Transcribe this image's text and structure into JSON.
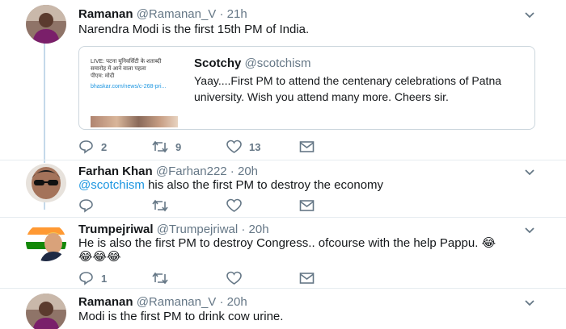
{
  "tweets": [
    {
      "name": "Ramanan",
      "meta": "@Ramanan_V · 21h",
      "text": "Narendra Modi is the first 15th PM of India.",
      "quoted": {
        "name": "Scotchy",
        "handle": "@scotchism",
        "text": "Yaay....First PM to attend the centenary celebrations of Patna university. Wish you attend many more. Cheers sir.",
        "thumb_lines": [
          "LIVE: पटना यूनिवर्सिटी के शताब्दी",
          "समारोह में आने वाला पहला",
          "पीएम: मोदी"
        ],
        "thumb_url": "bhaskar.com/news/c-268-pri..."
      },
      "replies": "2",
      "retweets": "9",
      "likes": "13"
    },
    {
      "name": "Farhan Khan",
      "meta": "@Farhan222 · 20h",
      "mention": "@scotchism",
      "text": " his also the first PM to destroy the economy",
      "replies": "",
      "retweets": "",
      "likes": ""
    },
    {
      "name": "Trumpejriwal",
      "meta": "@Trumpejriwal · 20h",
      "text": "He is also the first PM to destroy Congress..  ofcourse with the help Pappu. 😂",
      "text2": "😂😂😂",
      "replies": "1",
      "retweets": "",
      "likes": ""
    },
    {
      "name": "Ramanan",
      "meta": "@Ramanan_V · 20h",
      "text": "Modi is the first PM to drink cow urine."
    }
  ],
  "icons": {
    "reply": "reply-icon",
    "retweet": "retweet-icon",
    "like": "heart-icon",
    "dm": "mail-icon",
    "more": "chevron-down-icon"
  },
  "colors": {
    "accent": "#1b95e0",
    "meta": "#657786",
    "thread_line": "#c4d9ea"
  }
}
